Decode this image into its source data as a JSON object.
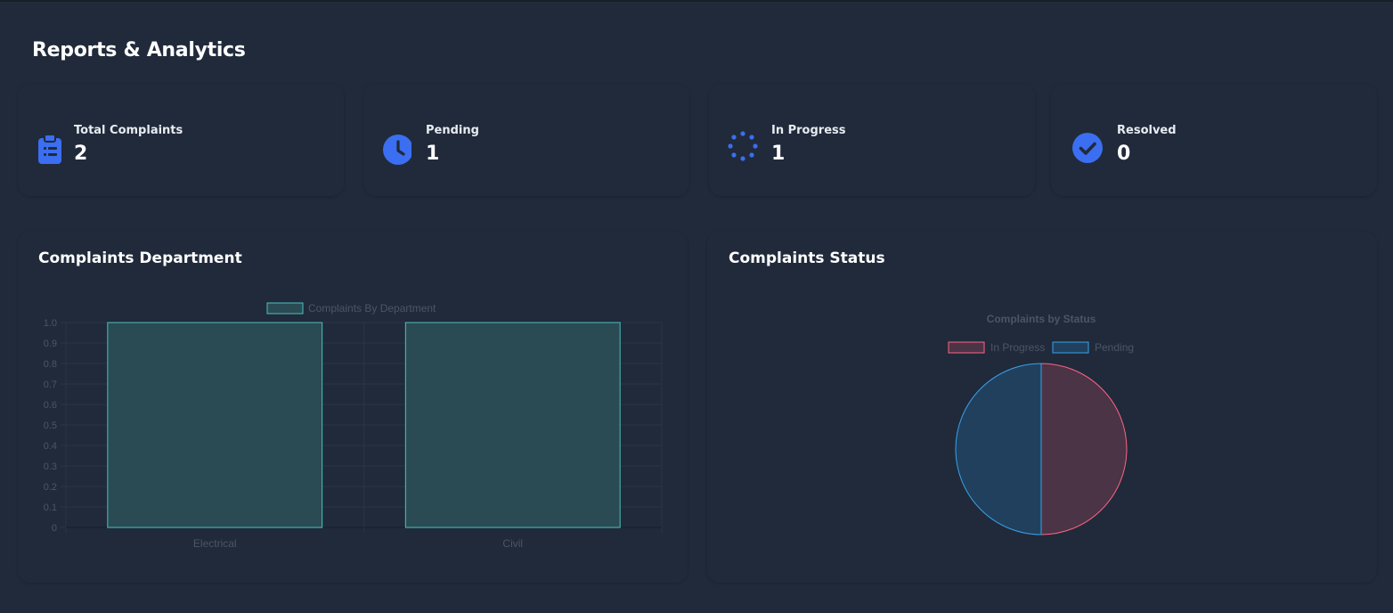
{
  "page": {
    "title": "Reports & Analytics"
  },
  "stats": [
    {
      "label": "Total Complaints",
      "value": "2",
      "icon": "clipboard-list-icon"
    },
    {
      "label": "Pending",
      "value": "1",
      "icon": "clock-icon"
    },
    {
      "label": "In Progress",
      "value": "1",
      "icon": "spinner-icon"
    },
    {
      "label": "Resolved",
      "value": "0",
      "icon": "check-circle-icon"
    }
  ],
  "colors": {
    "accent": "#3b6ef0",
    "bar_fill": "#2a4b54",
    "bar_border": "#4bc0c0",
    "pie_in_progress_fill": "#4a3446",
    "pie_in_progress_border": "#ff6384",
    "pie_pending_fill": "#21405e",
    "pie_pending_border": "#36a2eb"
  },
  "charts": {
    "department_title": "Complaints Department",
    "status_title": "Complaints Status"
  },
  "chart_data": [
    {
      "type": "bar",
      "legend": [
        "Complaints By Department"
      ],
      "categories": [
        "Electrical",
        "Civil"
      ],
      "series": [
        {
          "name": "Complaints By Department",
          "values": [
            1,
            1
          ]
        }
      ],
      "yticks": [
        "0",
        "0.1",
        "0.2",
        "0.3",
        "0.4",
        "0.5",
        "0.6",
        "0.7",
        "0.8",
        "0.9",
        "1.0"
      ],
      "ylim": [
        0,
        1
      ],
      "grid": true,
      "legend_position": "top"
    },
    {
      "type": "pie",
      "title": "Complaints by Status",
      "labels": [
        "In Progress",
        "Pending"
      ],
      "values": [
        1,
        1
      ],
      "legend_position": "top"
    }
  ]
}
